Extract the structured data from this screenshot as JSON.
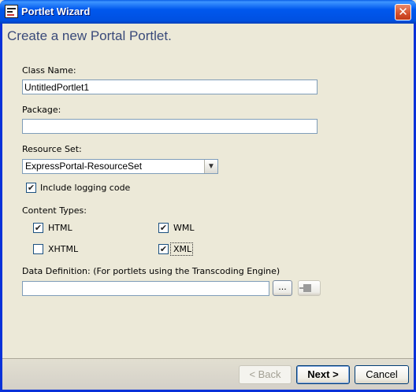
{
  "window": {
    "title": "Portlet Wizard",
    "close_glyph": "✕"
  },
  "heading": "Create a new Portal Portlet.",
  "class_name": {
    "label": "Class Name:",
    "value": "UntitledPortlet1"
  },
  "package": {
    "label": "Package:",
    "value": ""
  },
  "resource_set": {
    "label": "Resource Set:",
    "selected": "ExpressPortal-ResourceSet",
    "arrow": "▼"
  },
  "logging": {
    "label": "Include logging code",
    "checked": true
  },
  "content_types": {
    "label": "Content Types:",
    "items": [
      {
        "label": "HTML",
        "checked": true
      },
      {
        "label": "WML",
        "checked": true
      },
      {
        "label": "XHTML",
        "checked": false
      },
      {
        "label": "XML",
        "checked": true
      }
    ]
  },
  "data_definition": {
    "label": "Data Definition: (For portlets using the Transcoding Engine)",
    "value": "",
    "browse_label": "..."
  },
  "buttons": {
    "back": "< Back",
    "next": "Next >",
    "cancel": "Cancel"
  },
  "check_glyph": "✔"
}
